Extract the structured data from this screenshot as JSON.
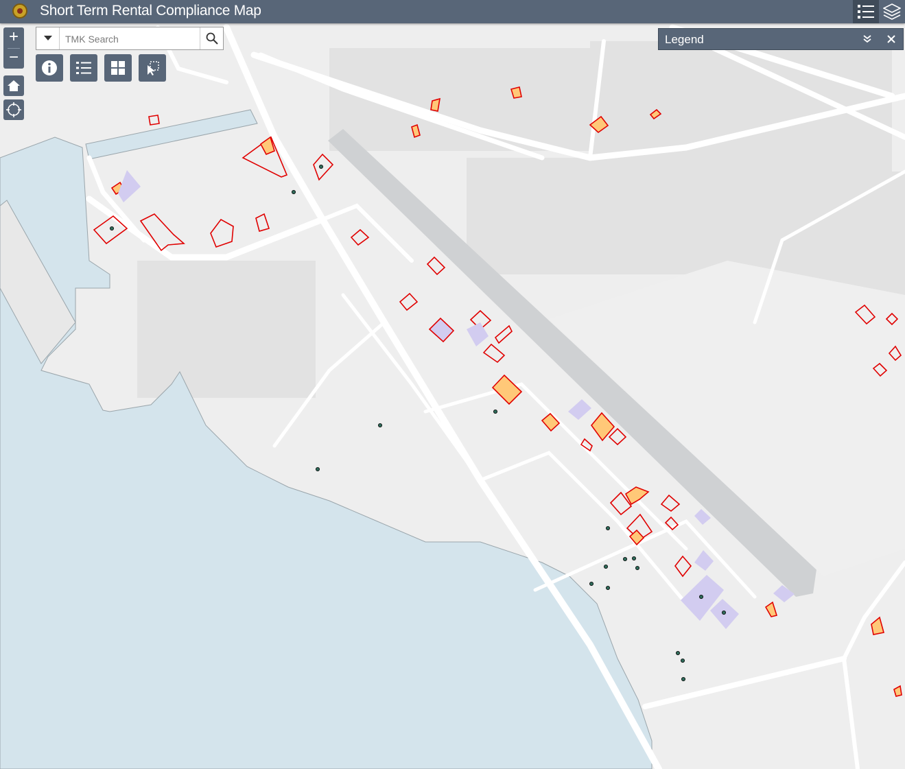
{
  "app": {
    "title": "Short Term Rental Compliance Map"
  },
  "header": {
    "buttons": [
      {
        "name": "legend-list-icon",
        "active": true
      },
      {
        "name": "layers-icon",
        "active": false
      }
    ]
  },
  "search": {
    "placeholder": "TMK Search",
    "value": ""
  },
  "legend_panel": {
    "title": "Legend"
  },
  "tools": [
    {
      "name": "info-icon"
    },
    {
      "name": "list-icon"
    },
    {
      "name": "basemap-grid-icon"
    },
    {
      "name": "select-tool-icon"
    }
  ],
  "colors": {
    "header": "#586678",
    "water": "#d4e4ec",
    "land": "#eeeeee",
    "road": "#ffffff",
    "runway": "#cfd1d3",
    "parcel_outline": "#e00000",
    "parcel_orange": "#ffc878",
    "parcel_purple": "#d2ccf0",
    "point": "#2f6b5a"
  }
}
